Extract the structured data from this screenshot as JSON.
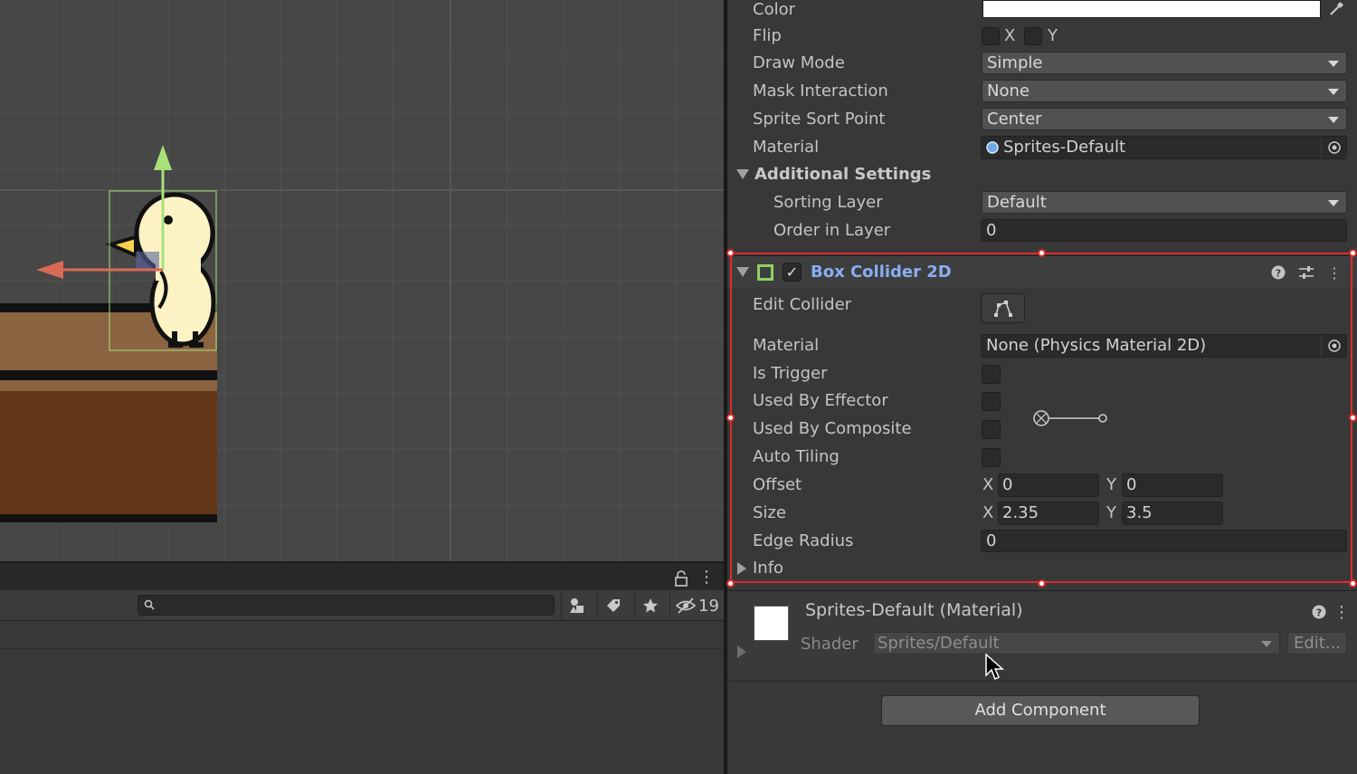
{
  "inspector": {
    "sprite_renderer": {
      "color_label": "Color",
      "color_value": "#ffffff",
      "flip_label": "Flip",
      "flip_x": "X",
      "flip_y": "Y",
      "draw_mode_label": "Draw Mode",
      "draw_mode_value": "Simple",
      "mask_interaction_label": "Mask Interaction",
      "mask_interaction_value": "None",
      "sprite_sort_point_label": "Sprite Sort Point",
      "sprite_sort_point_value": "Center",
      "material_label": "Material",
      "material_value": "Sprites-Default",
      "additional_settings_label": "Additional Settings",
      "sorting_layer_label": "Sorting Layer",
      "sorting_layer_value": "Default",
      "order_in_layer_label": "Order in Layer",
      "order_in_layer_value": "0"
    },
    "box_collider": {
      "title": "Box Collider 2D",
      "enabled": true,
      "edit_collider_label": "Edit Collider",
      "material_label": "Material",
      "material_value": "None (Physics Material 2D)",
      "is_trigger_label": "Is Trigger",
      "used_by_effector_label": "Used By Effector",
      "used_by_composite_label": "Used By Composite",
      "auto_tiling_label": "Auto Tiling",
      "offset_label": "Offset",
      "offset_x_label": "X",
      "offset_x": "0",
      "offset_y_label": "Y",
      "offset_y": "0",
      "size_label": "Size",
      "size_x_label": "X",
      "size_x": "2.35",
      "size_y_label": "Y",
      "size_y": "3.5",
      "edge_radius_label": "Edge Radius",
      "edge_radius_value": "0",
      "info_label": "Info"
    },
    "material_section": {
      "title": "Sprites-Default (Material)",
      "shader_label": "Shader",
      "shader_value": "Sprites/Default",
      "edit_label": "Edit..."
    },
    "add_component_label": "Add Component"
  },
  "project_panel": {
    "search_placeholder": "",
    "hidden_count": "19"
  },
  "colors": {
    "selection_outline": "#e02a2a",
    "component_title": "#88aef0",
    "collider_icon": "#8fd060"
  }
}
